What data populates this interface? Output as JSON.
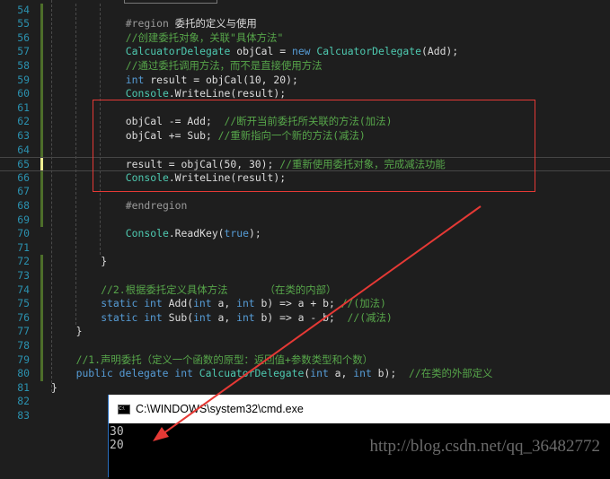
{
  "colors": {
    "keyword": "#569cd6",
    "type": "#4ec9b0",
    "comment": "#57a64a",
    "text": "#dcdcdc",
    "preprocessor": "#9b9b9b",
    "line_number": "#2b91af",
    "annotation": "#e53935"
  },
  "editor": {
    "current_line": 65,
    "lines": [
      {
        "num": "54",
        "indent": 3,
        "tokens": []
      },
      {
        "num": "55",
        "indent": 3,
        "tokens": [
          {
            "t": "#region ",
            "c": "pp"
          },
          {
            "t": "委托的定义与使用",
            "c": "tx"
          }
        ]
      },
      {
        "num": "56",
        "indent": 3,
        "tokens": [
          {
            "t": "//创建委托对象，关联\"具体方法\"",
            "c": "cm"
          }
        ]
      },
      {
        "num": "57",
        "indent": 3,
        "tokens": [
          {
            "t": "CalcuatorDelegate",
            "c": "ty"
          },
          {
            "t": " objCal = ",
            "c": "tx"
          },
          {
            "t": "new",
            "c": "kw"
          },
          {
            "t": " ",
            "c": "tx"
          },
          {
            "t": "CalcuatorDelegate",
            "c": "ty"
          },
          {
            "t": "(Add);",
            "c": "tx"
          }
        ]
      },
      {
        "num": "58",
        "indent": 3,
        "tokens": [
          {
            "t": "//通过委托调用方法，而不是直接使用方法",
            "c": "cm"
          }
        ]
      },
      {
        "num": "59",
        "indent": 3,
        "tokens": [
          {
            "t": "int",
            "c": "kw"
          },
          {
            "t": " result = objCal(10, 20);",
            "c": "tx"
          }
        ]
      },
      {
        "num": "60",
        "indent": 3,
        "tokens": [
          {
            "t": "Console",
            "c": "ty"
          },
          {
            "t": ".WriteLine(result);",
            "c": "tx"
          }
        ]
      },
      {
        "num": "61",
        "indent": 3,
        "tokens": []
      },
      {
        "num": "62",
        "indent": 3,
        "tokens": [
          {
            "t": "objCal -= Add;  ",
            "c": "tx"
          },
          {
            "t": "//断开当前委托所关联的方法(加法)",
            "c": "cm"
          }
        ]
      },
      {
        "num": "63",
        "indent": 3,
        "tokens": [
          {
            "t": "objCal += Sub; ",
            "c": "tx"
          },
          {
            "t": "//重新指向一个新的方法(减法)",
            "c": "cm"
          }
        ]
      },
      {
        "num": "64",
        "indent": 3,
        "tokens": []
      },
      {
        "num": "65",
        "indent": 3,
        "tokens": [
          {
            "t": "result = objCal(50, 30); ",
            "c": "tx"
          },
          {
            "t": "//重新使用委托对象，完成减法功能",
            "c": "cm"
          }
        ]
      },
      {
        "num": "66",
        "indent": 3,
        "tokens": [
          {
            "t": "Console",
            "c": "ty"
          },
          {
            "t": ".WriteLine(result);",
            "c": "tx"
          }
        ]
      },
      {
        "num": "67",
        "indent": 3,
        "tokens": []
      },
      {
        "num": "68",
        "indent": 3,
        "tokens": [
          {
            "t": "#endregion",
            "c": "pp"
          }
        ]
      },
      {
        "num": "69",
        "indent": 3,
        "tokens": []
      },
      {
        "num": "70",
        "indent": 3,
        "tokens": [
          {
            "t": "Console",
            "c": "ty"
          },
          {
            "t": ".ReadKey(",
            "c": "tx"
          },
          {
            "t": "true",
            "c": "kw"
          },
          {
            "t": ");",
            "c": "tx"
          }
        ]
      },
      {
        "num": "71",
        "indent": 3,
        "tokens": []
      },
      {
        "num": "72",
        "indent": 2,
        "tokens": [
          {
            "t": "}",
            "c": "tx"
          }
        ]
      },
      {
        "num": "73",
        "indent": 2,
        "tokens": []
      },
      {
        "num": "74",
        "indent": 2,
        "tokens": [
          {
            "t": "//2.根据委托定义具体方法      （在类的内部）",
            "c": "cm"
          }
        ]
      },
      {
        "num": "75",
        "indent": 2,
        "tokens": [
          {
            "t": "static",
            "c": "kw"
          },
          {
            "t": " ",
            "c": "tx"
          },
          {
            "t": "int",
            "c": "kw"
          },
          {
            "t": " Add(",
            "c": "tx"
          },
          {
            "t": "int",
            "c": "kw"
          },
          {
            "t": " a, ",
            "c": "tx"
          },
          {
            "t": "int",
            "c": "kw"
          },
          {
            "t": " b) => a + b; ",
            "c": "tx"
          },
          {
            "t": "//(加法)",
            "c": "cm"
          }
        ]
      },
      {
        "num": "76",
        "indent": 2,
        "tokens": [
          {
            "t": "static",
            "c": "kw"
          },
          {
            "t": " ",
            "c": "tx"
          },
          {
            "t": "int",
            "c": "kw"
          },
          {
            "t": " Sub(",
            "c": "tx"
          },
          {
            "t": "int",
            "c": "kw"
          },
          {
            "t": " a, ",
            "c": "tx"
          },
          {
            "t": "int",
            "c": "kw"
          },
          {
            "t": " b) => a - b;  ",
            "c": "tx"
          },
          {
            "t": "//(减法)",
            "c": "cm"
          }
        ]
      },
      {
        "num": "77",
        "indent": 1,
        "tokens": [
          {
            "t": "}",
            "c": "tx"
          }
        ]
      },
      {
        "num": "78",
        "indent": 1,
        "tokens": []
      },
      {
        "num": "79",
        "indent": 1,
        "tokens": [
          {
            "t": "//1.声明委托（定义一个函数的原型：返回值+参数类型和个数）",
            "c": "cm"
          }
        ]
      },
      {
        "num": "80",
        "indent": 1,
        "tokens": [
          {
            "t": "public",
            "c": "kw"
          },
          {
            "t": " ",
            "c": "tx"
          },
          {
            "t": "delegate",
            "c": "kw"
          },
          {
            "t": " ",
            "c": "tx"
          },
          {
            "t": "int",
            "c": "kw"
          },
          {
            "t": " ",
            "c": "tx"
          },
          {
            "t": "CalcuatorDelegate",
            "c": "ty"
          },
          {
            "t": "(",
            "c": "tx"
          },
          {
            "t": "int",
            "c": "kw"
          },
          {
            "t": " a, ",
            "c": "tx"
          },
          {
            "t": "int",
            "c": "kw"
          },
          {
            "t": " b);  ",
            "c": "tx"
          },
          {
            "t": "//在类的外部定义",
            "c": "cm"
          }
        ]
      },
      {
        "num": "81",
        "indent": 0,
        "tokens": [
          {
            "t": "}",
            "c": "tx"
          }
        ]
      },
      {
        "num": "82",
        "indent": 0,
        "tokens": []
      },
      {
        "num": "83",
        "indent": 0,
        "tokens": []
      }
    ]
  },
  "console": {
    "title": "C:\\WINDOWS\\system32\\cmd.exe",
    "icon": "cmd-icon",
    "output": [
      "30",
      "20"
    ],
    "watermark": "http://blog.csdn.net/qq_36482772"
  }
}
